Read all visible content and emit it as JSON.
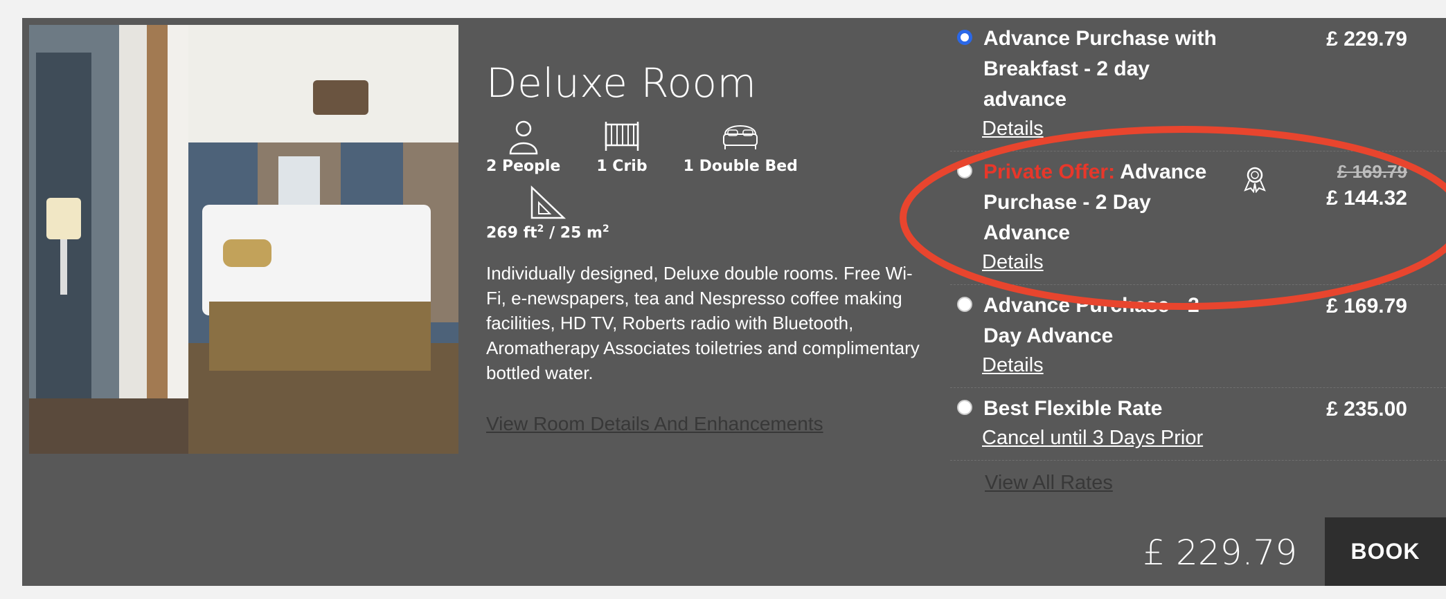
{
  "room": {
    "title": "Deluxe Room",
    "features": [
      {
        "label": "2 People",
        "icon": "person-icon"
      },
      {
        "label": "1 Crib",
        "icon": "crib-icon"
      },
      {
        "label": "1 Double Bed",
        "icon": "bed-icon"
      }
    ],
    "size_ft": "269 ft",
    "size_m": " / 25 m",
    "size_exp": "2",
    "description": "Individually designed, Deluxe double rooms. Free Wi-Fi, e-newspapers, tea and Nespresso coffee making facilities, HD TV, Roberts radio with Bluetooth, Aromatherapy Associates toiletries and complimentary bottled water.",
    "details_link": "View Room Details And Enhancements"
  },
  "rates": [
    {
      "name": "Advance Purchase with Breakfast - 2 day advance",
      "link": "Details",
      "price": "£ 229.79",
      "selected": true
    },
    {
      "offer_label": "Private Offer:",
      "name": " Advance Purchase - 2 Day Advance",
      "link": "Details",
      "old_price": "£ 169.79",
      "price": "£ 144.32",
      "selected": false
    },
    {
      "name": "Advance Purchase - 2 Day Advance",
      "link": "Details",
      "price": "£ 169.79",
      "selected": false
    },
    {
      "name": "Best Flexible Rate",
      "link": "Cancel until 3 Days Prior",
      "price": "£ 235.00",
      "selected": false
    }
  ],
  "view_all_rates": "View All Rates",
  "total_price": "£ 229.79",
  "book_label": "BOOK",
  "colors": {
    "card_bg": "#585858",
    "offer_red": "#e8372a",
    "annotation_red": "#e8452e",
    "radio_blue": "#2b68e8",
    "book_bg": "#2e2e2e"
  }
}
